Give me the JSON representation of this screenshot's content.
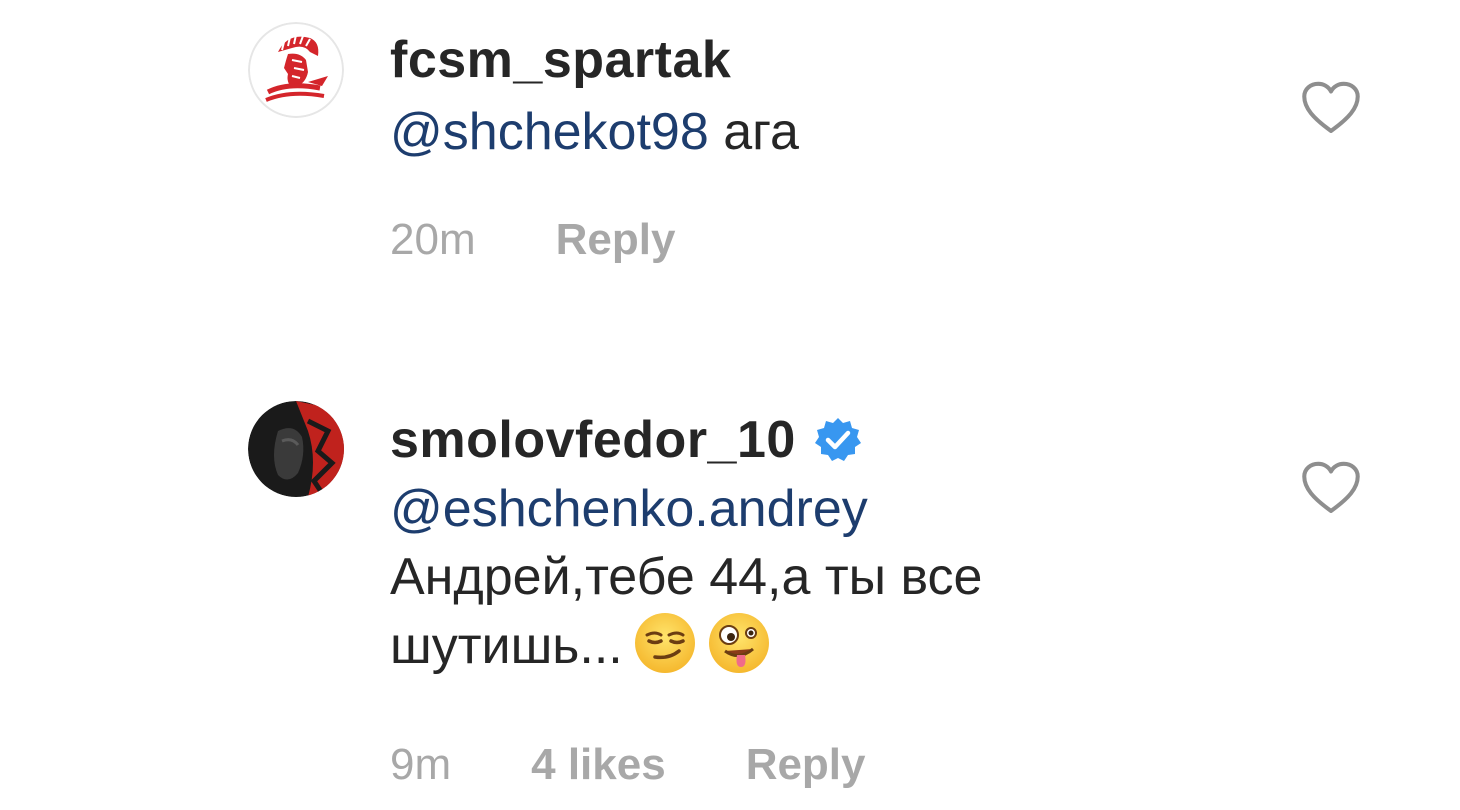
{
  "comments": [
    {
      "username": "fcsm_spartak",
      "verified": false,
      "mention": "@shchekot98",
      "text": " ага",
      "time": "20m",
      "likes": "",
      "reply_label": "Reply",
      "avatar_icon": "spartak-logo-icon",
      "colors": {
        "avatar_accent": "#d4252b"
      }
    },
    {
      "username": "smolovfedor_10",
      "verified": true,
      "mention": "@eshchenko.andrey",
      "text_line1": "Андрей,тебе 44,а ты все",
      "text_line2": "шутишь...",
      "emojis": [
        "smirking-face-emoji",
        "zany-face-emoji"
      ],
      "time": "9m",
      "likes": "4 likes",
      "reply_label": "Reply",
      "avatar_icon": "profile-photo-icon",
      "colors": {
        "avatar_accent": "#c0221d"
      }
    }
  ],
  "colors": {
    "mention": "#1d3d6e",
    "meta": "#a8a8a8",
    "text": "#262626",
    "verified": "#3897f0"
  }
}
